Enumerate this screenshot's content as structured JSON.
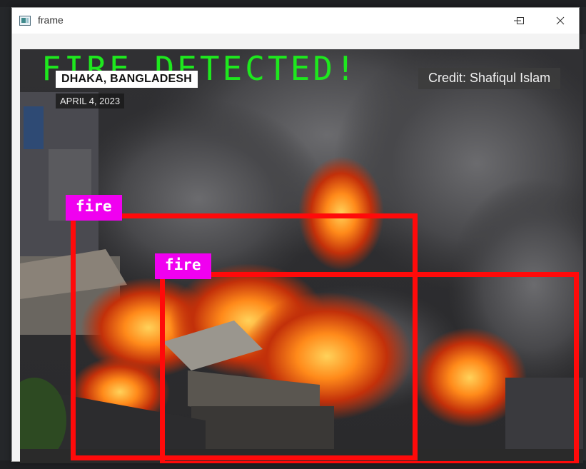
{
  "window": {
    "title": "frame",
    "icon": "frame-app-icon",
    "controls": {
      "minimize": "minimize-icon",
      "maximize": "maximize-icon",
      "close": "close-icon"
    }
  },
  "frame": {
    "status_text": "FIRE DETECTED!",
    "status_color": "#1ee81e",
    "location": "DHAKA, BANGLADESH",
    "date": "APRIL 4, 2023",
    "credit": "Credit: Shafiqul Islam",
    "detections": [
      {
        "label": "fire",
        "label_color": "#f000f0",
        "box_color": "#ff0a0a"
      },
      {
        "label": "fire",
        "label_color": "#f000f0",
        "box_color": "#ff0a0a"
      }
    ]
  }
}
